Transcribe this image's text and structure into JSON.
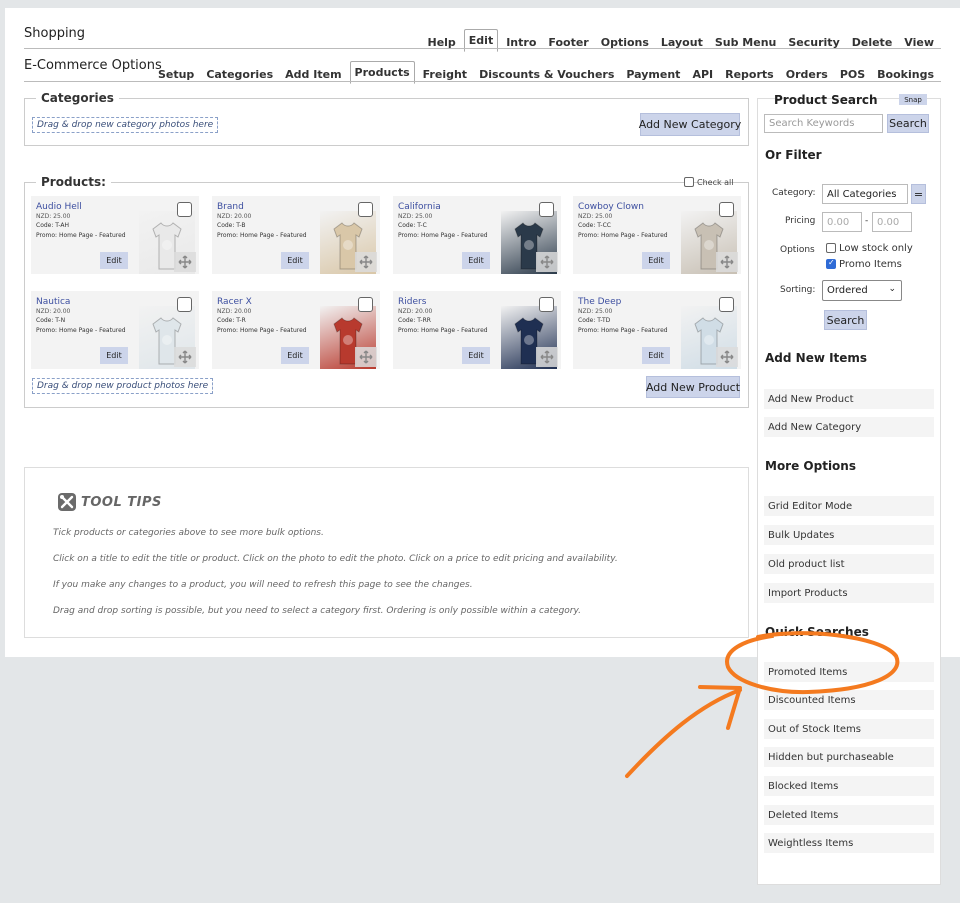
{
  "header": {
    "title": "Shopping",
    "tabs": [
      "Help",
      "Edit",
      "Intro",
      "Footer",
      "Options",
      "Layout",
      "Sub Menu",
      "Security",
      "Delete",
      "View"
    ],
    "active_tab": "Edit"
  },
  "subheader": {
    "title": "E-Commerce Options",
    "tabs": [
      "Setup",
      "Categories",
      "Add Item",
      "Products",
      "Freight",
      "Discounts & Vouchers",
      "Payment",
      "API",
      "Reports",
      "Orders",
      "POS",
      "Bookings"
    ],
    "active_tab": "Products"
  },
  "categories_panel": {
    "legend": "Categories",
    "dropzone": "Drag & drop new category photos here",
    "add_button": "Add New Category"
  },
  "products_panel": {
    "legend": "Products:",
    "check_all": "Check all",
    "edit_label": "Edit",
    "dropzone": "Drag & drop new product photos here",
    "add_button": "Add New Product",
    "products": [
      {
        "name": "Audio Hell",
        "price": "NZD: 25.00",
        "code": "Code: T-AH",
        "promo": "Promo: Home Page - Featured"
      },
      {
        "name": "Brand",
        "price": "NZD: 20.00",
        "code": "Code: T-B",
        "promo": "Promo: Home Page - Featured"
      },
      {
        "name": "California",
        "price": "NZD: 25.00",
        "code": "Code: T-C",
        "promo": "Promo: Home Page - Featured"
      },
      {
        "name": "Cowboy Clown",
        "price": "NZD: 25.00",
        "code": "Code: T-CC",
        "promo": "Promo: Home Page - Featured"
      },
      {
        "name": "Nautica",
        "price": "NZD: 20.00",
        "code": "Code: T-N",
        "promo": "Promo: Home Page - Featured"
      },
      {
        "name": "Racer X",
        "price": "NZD: 20.00",
        "code": "Code: T-R",
        "promo": "Promo: Home Page - Featured"
      },
      {
        "name": "Riders",
        "price": "NZD: 20.00",
        "code": "Code: T-RR",
        "promo": "Promo: Home Page - Featured"
      },
      {
        "name": "The Deep",
        "price": "NZD: 25.00",
        "code": "Code: T-TD",
        "promo": "Promo: Home Page - Featured"
      }
    ],
    "photo_colors": [
      "#e9e9e9",
      "#d9c7a8",
      "#2b3a4a",
      "#c8c0b4",
      "#dfe6ea",
      "#b83a2e",
      "#1f2f52",
      "#d0dde6"
    ]
  },
  "tooltips": {
    "title": "TOOL TIPS",
    "lines": [
      "Tick products or categories above to see more bulk options.",
      "Click on a title to edit the title or product. Click on the photo to edit the photo. Click on a price to edit pricing and availability.",
      "If you make any changes to a product, you will need to refresh this page to see the changes.",
      "Drag and drop sorting is possible, but you need to select a category first. Ordering is only possible within a category."
    ]
  },
  "sidebar": {
    "product_search": {
      "title": "Product Search",
      "snap": "Snap",
      "placeholder": "Search Keywords",
      "button": "Search"
    },
    "filter": {
      "title": "Or Filter",
      "category_label": "Category:",
      "category_value": "All Categories",
      "equals": "=",
      "pricing_label": "Pricing",
      "price_from": "0.00",
      "price_dash": "-",
      "price_to": "0.00",
      "options_label": "Options",
      "low_stock": "Low stock only",
      "promo_items": "Promo Items",
      "sorting_label": "Sorting:",
      "sorting_value": "Ordered",
      "search_button": "Search"
    },
    "add_new": {
      "title": "Add New Items",
      "items": [
        "Add New Product",
        "Add New Category"
      ]
    },
    "more_options": {
      "title": "More Options",
      "items": [
        "Grid Editor Mode",
        "Bulk Updates",
        "Old product list",
        "Import Products"
      ]
    },
    "quick_searches": {
      "title": "Quick Searches",
      "items": [
        "Promoted Items",
        "Discounted Items",
        "Out of Stock Items",
        "Hidden but purchaseable",
        "Blocked Items",
        "Deleted Items",
        "Weightless Items"
      ]
    }
  },
  "annotation_color": "#f47a1f"
}
